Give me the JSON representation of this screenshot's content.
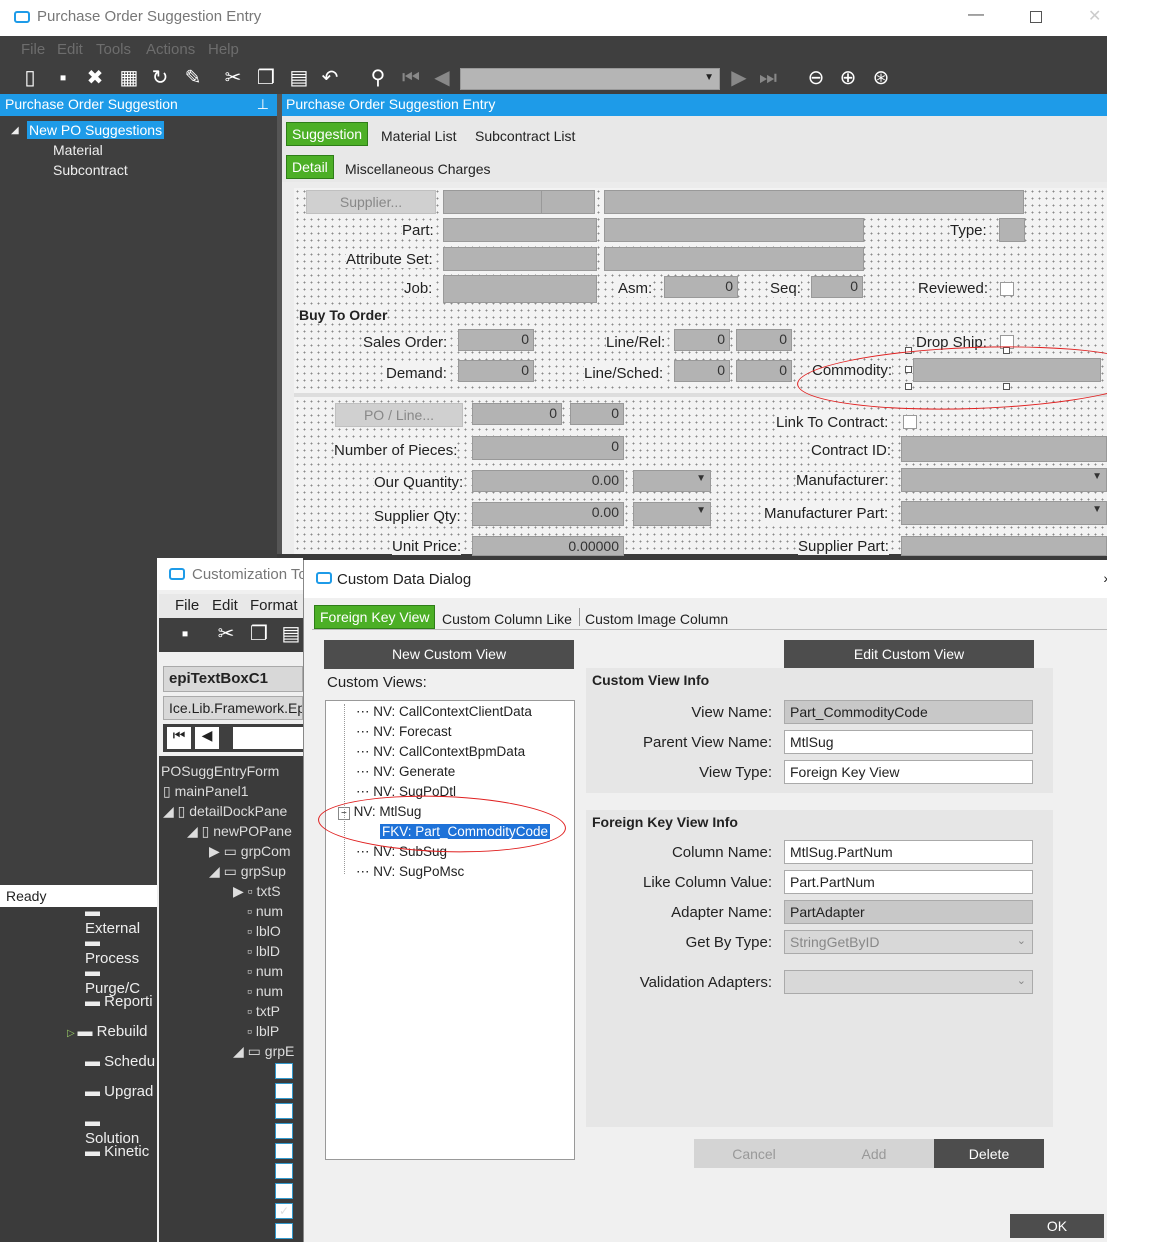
{
  "main_window": {
    "title": "Purchase Order Suggestion Entry",
    "menu": [
      "File",
      "Edit",
      "Tools",
      "Actions",
      "Help"
    ],
    "left_panel": {
      "header": "Purchase Order Suggestion",
      "tree": [
        "New PO Suggestions",
        "Material",
        "Subcontract"
      ]
    },
    "status": "Ready",
    "panel_title": "Purchase Order Suggestion Entry",
    "tabs": [
      "Suggestion",
      "Material List",
      "Subcontract List"
    ],
    "subtabs": [
      "Detail",
      "Miscellaneous Charges"
    ],
    "form": {
      "supplier_btn": "Supplier...",
      "part": "Part:",
      "type": "Type:",
      "attribute_set": "Attribute Set:",
      "job": "Job:",
      "asm": "Asm:",
      "asm_val": "0",
      "seq": "Seq:",
      "seq_val": "0",
      "reviewed": "Reviewed:",
      "buy_to_order": "Buy To Order",
      "sales_order": "Sales Order:",
      "sales_order_val": "0",
      "line_rel": "Line/Rel:",
      "line_rel_val1": "0",
      "line_rel_val2": "0",
      "drop_ship": "Drop Ship:",
      "demand": "Demand:",
      "demand_val": "0",
      "line_sched": "Line/Sched:",
      "line_sched_val1": "0",
      "line_sched_val2": "0",
      "commodity": "Commodity:",
      "po_line_btn": "PO / Line...",
      "po_val1": "0",
      "po_val2": "0",
      "link_to_contract": "Link To Contract:",
      "number_of_pieces": "Number of Pieces:",
      "pieces_val": "0",
      "contract_id": "Contract ID:",
      "our_quantity": "Our Quantity:",
      "our_qty_val": "0.00",
      "manufacturer": "Manufacturer:",
      "supplier_qty": "Supplier Qty:",
      "supplier_qty_val": "0.00",
      "manufacturer_part": "Manufacturer Part:",
      "unit_price": "Unit Price:",
      "unit_price_val": "0.00000",
      "supplier_part": "Supplier Part:"
    }
  },
  "customization": {
    "title": "Customization To",
    "menu": [
      "File",
      "Edit",
      "Format"
    ],
    "control": "epiTextBoxC1",
    "type": "Ice.Lib.Framework.Ep",
    "tree": [
      "POSuggEntryForm",
      "mainPanel1",
      "detailDockPane",
      "newPOPane",
      "grpCom",
      "grpSup",
      "txtS",
      "num",
      "lblO",
      "lblD",
      "num",
      "num",
      "txtP",
      "lblP",
      "grpE"
    ]
  },
  "bg_menu": [
    "External",
    "Process",
    "Purge/C",
    "Reporti",
    "Rebuild",
    "Schedu",
    "Upgrad",
    "Solution",
    "Kinetic"
  ],
  "dialog": {
    "title": "Custom Data Dialog",
    "tabs": [
      "Foreign Key View",
      "Custom Column Like",
      "Custom Image Column"
    ],
    "new_btn": "New Custom View",
    "edit_btn": "Edit Custom View",
    "views_label": "Custom Views:",
    "tree": [
      "NV: CallContextClientData",
      "NV: Forecast",
      "NV: CallContextBpmData",
      "NV: Generate",
      "NV: SugPoDtl",
      "NV: MtlSug",
      "FKV: Part_CommodityCode",
      "NV: SubSug",
      "NV: SugPoMsc"
    ],
    "view_info": {
      "title": "Custom View Info",
      "view_name_lbl": "View Name:",
      "view_name": "Part_CommodityCode",
      "parent_lbl": "Parent View Name:",
      "parent": "MtlSug",
      "type_lbl": "View Type:",
      "type": "Foreign Key View"
    },
    "fk_info": {
      "title": "Foreign Key View Info",
      "col_lbl": "Column Name:",
      "col": "MtlSug.PartNum",
      "like_lbl": "Like Column Value:",
      "like": "Part.PartNum",
      "adapter_lbl": "Adapter Name:",
      "adapter": "PartAdapter",
      "getby_lbl": "Get By Type:",
      "getby": "StringGetByID",
      "valid_lbl": "Validation Adapters:"
    },
    "cancel": "Cancel",
    "add": "Add",
    "delete": "Delete",
    "ok": "OK"
  }
}
